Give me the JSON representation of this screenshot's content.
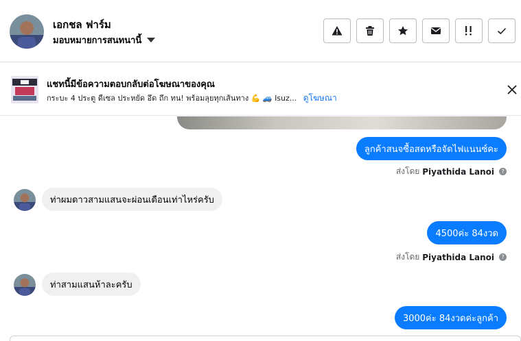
{
  "header": {
    "contact_name": "เอกชล ฟาร์ม",
    "assign_label": "มอบหมายการสนทนานี้",
    "actions": [
      {
        "name": "report-button",
        "icon": "warning-icon"
      },
      {
        "name": "delete-button",
        "icon": "trash-icon"
      },
      {
        "name": "star-button",
        "icon": "star-icon"
      },
      {
        "name": "mark-unread-button",
        "icon": "envelope-icon"
      },
      {
        "name": "follow-up-button",
        "icon": "follow-up-icon"
      },
      {
        "name": "mark-done-button",
        "icon": "check-icon"
      }
    ]
  },
  "ad_banner": {
    "title": "แชทนี้มีข้อความตอบกลับต่อโฆษณาของคุณ",
    "description": "กระบะ 4 ประตู ดีเซล ประหยัด อึด ถึก ทน! พร้อมลุยทุกเส้นทาง 💪 🚙 Isuz...",
    "view_ad_link": "ดูโฆษณา"
  },
  "messages": [
    {
      "direction": "out",
      "text": "ลูกค้าสนจซื้อสดหรือจัดไฟแนนซ์คะ"
    },
    {
      "direction": "meta",
      "prefix": "ส่งโดย",
      "sender": "Piyathida Lanoi"
    },
    {
      "direction": "in",
      "text": "ท่าผมดาวสามแสนจะผ่อนเดือนเท่าไหร่ครับ"
    },
    {
      "direction": "out",
      "text": "4500ค่ะ 84งวด"
    },
    {
      "direction": "meta",
      "prefix": "ส่งโดย",
      "sender": "Piyathida Lanoi"
    },
    {
      "direction": "in",
      "text": "ท่าสามแสนห้าละครับ"
    },
    {
      "direction": "out",
      "text": "3000ค่ะ 84งวดค่ะลูกค้า"
    }
  ],
  "colors": {
    "outgoing_bubble": "#0a7cff",
    "incoming_bubble": "#f0f0f0",
    "link": "#1877f2"
  }
}
